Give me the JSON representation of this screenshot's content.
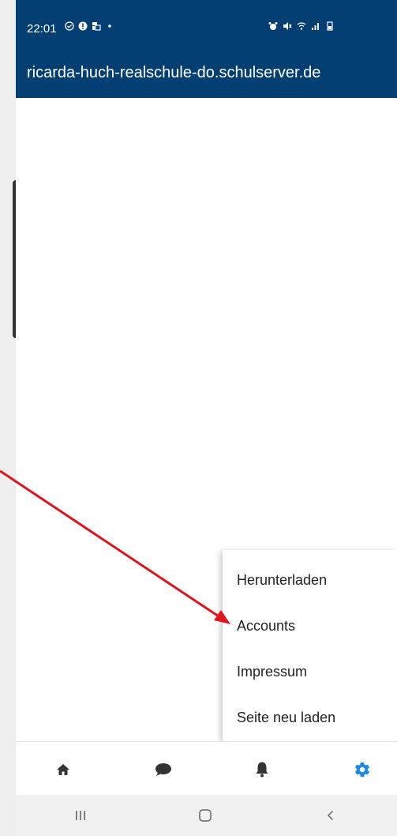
{
  "status_bar": {
    "time": "22:01",
    "left_icons": [
      "check-circle-icon",
      "alert-icon",
      "sim-icon",
      "dot-icon"
    ],
    "right_icons": [
      "alarm-icon",
      "mute-icon",
      "wifi-icon",
      "signal-icon",
      "battery-icon"
    ]
  },
  "app_bar": {
    "title": "ricarda-huch-realschule-do.schulserver.de"
  },
  "menu": {
    "items": [
      {
        "label": "Herunterladen"
      },
      {
        "label": "Accounts"
      },
      {
        "label": "Impressum"
      },
      {
        "label": "Seite neu laden"
      }
    ]
  },
  "bottom_nav": {
    "items": [
      {
        "icon": "home-icon",
        "active": false
      },
      {
        "icon": "chat-icon",
        "active": false
      },
      {
        "icon": "bell-icon",
        "active": false
      },
      {
        "icon": "gear-icon",
        "active": true
      }
    ],
    "active_color": "#1e88e5",
    "inactive_color": "#333333"
  },
  "system_nav": {
    "items": [
      "recent-apps-icon",
      "home-outline-icon",
      "back-icon"
    ]
  },
  "colors": {
    "header": "#033f73",
    "annotation_arrow": "#e0141b"
  }
}
